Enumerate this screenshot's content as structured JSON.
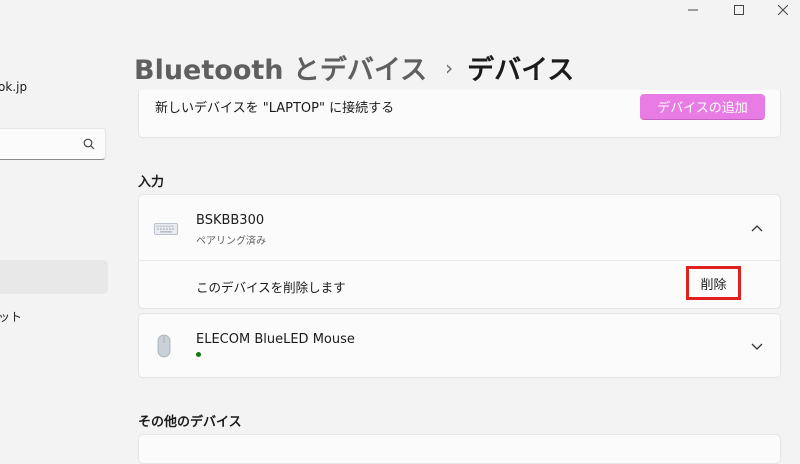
{
  "window": {
    "minimize_icon": "minimize-icon",
    "maximize_icon": "maximize-icon",
    "close_icon": "close-icon"
  },
  "sidebar": {
    "account_fragment": "ok.jp",
    "search_placeholder": "",
    "nav_fragment": "ット"
  },
  "header": {
    "parent": "Bluetooth とデバイス",
    "separator": "›",
    "current": "デバイス"
  },
  "add_device": {
    "label": "新しいデバイスを \"LAPTOP\" に接続する",
    "button": "デバイスの追加",
    "button_color": "#e87ce4"
  },
  "sections": {
    "input": "入力",
    "other": "その他のデバイス"
  },
  "devices": [
    {
      "name": "BSKBB300",
      "status": "ペアリング済み",
      "icon": "keyboard-icon",
      "expanded": true,
      "remove_label": "このデバイスを削除します",
      "remove_button": "削除",
      "highlight_color": "#e0201e"
    },
    {
      "name": "ELECOM BlueLED Mouse",
      "status_color": "#107c10",
      "icon": "mouse-icon",
      "expanded": false
    }
  ]
}
